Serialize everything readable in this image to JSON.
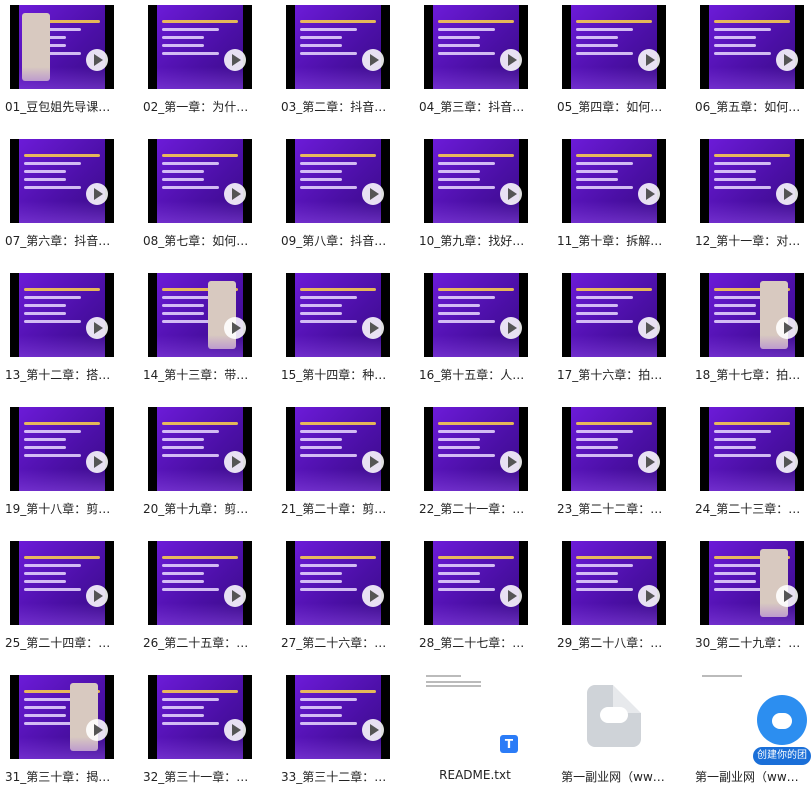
{
  "files": [
    {
      "name": "01_豆包姐先导课…",
      "kind": "video"
    },
    {
      "name": "02_第一章：为什…",
      "kind": "video"
    },
    {
      "name": "03_第二章：抖音…",
      "kind": "video"
    },
    {
      "name": "04_第三章：抖音…",
      "kind": "video"
    },
    {
      "name": "05_第四章：如何…",
      "kind": "video"
    },
    {
      "name": "06_第五章：如何…",
      "kind": "video"
    },
    {
      "name": "07_第六章：抖音…",
      "kind": "video"
    },
    {
      "name": "08_第七章：如何…",
      "kind": "video"
    },
    {
      "name": "09_第八章：抖音…",
      "kind": "video"
    },
    {
      "name": "10_第九章：找好…",
      "kind": "video"
    },
    {
      "name": "11_第十章：拆解…",
      "kind": "video"
    },
    {
      "name": "12_第十一章：对…",
      "kind": "video"
    },
    {
      "name": "13_第十二章：搭…",
      "kind": "video"
    },
    {
      "name": "14_第十三章：带…",
      "kind": "video"
    },
    {
      "name": "15_第十四章：种…",
      "kind": "video"
    },
    {
      "name": "16_第十五章：人…",
      "kind": "video"
    },
    {
      "name": "17_第十六章：拍…",
      "kind": "video"
    },
    {
      "name": "18_第十七章：拍…",
      "kind": "video"
    },
    {
      "name": "19_第十八章：剪…",
      "kind": "video"
    },
    {
      "name": "20_第十九章：剪…",
      "kind": "video"
    },
    {
      "name": "21_第二十章：剪…",
      "kind": "video"
    },
    {
      "name": "22_第二十一章：…",
      "kind": "video"
    },
    {
      "name": "23_第二十二章：…",
      "kind": "video"
    },
    {
      "name": "24_第二十三章：…",
      "kind": "video"
    },
    {
      "name": "25_第二十四章：…",
      "kind": "video"
    },
    {
      "name": "26_第二十五章：…",
      "kind": "video"
    },
    {
      "name": "27_第二十六章：…",
      "kind": "video"
    },
    {
      "name": "28_第二十七章：…",
      "kind": "video"
    },
    {
      "name": "29_第二十八章：…",
      "kind": "video"
    },
    {
      "name": "30_第二十九章：…",
      "kind": "video"
    },
    {
      "name": "31_第三十章：揭…",
      "kind": "video"
    },
    {
      "name": "32_第三十一章：…",
      "kind": "video"
    },
    {
      "name": "33_第三十二章：…",
      "kind": "video"
    },
    {
      "name": "README.txt",
      "kind": "text"
    },
    {
      "name": "第一副业网（ww…",
      "kind": "cloud"
    },
    {
      "name": "第一副业网（ww…",
      "kind": "doc"
    }
  ],
  "thumb_text": {
    "t01": "豆包姐",
    "t02": "学霸：为什么人人都能做抖",
    "t23": "你为什么要投DOU+?",
    "t25": "话题人数是抖音的垂直人数吗?",
    "t30": "三种引流到店方式"
  },
  "txt_badge": "T",
  "floating_badge": {
    "label": "创建你的团",
    "icon": "cloud-upload-icon"
  },
  "colors": {
    "accent": "#6c1bd8",
    "badge": "#2b7cf7"
  }
}
